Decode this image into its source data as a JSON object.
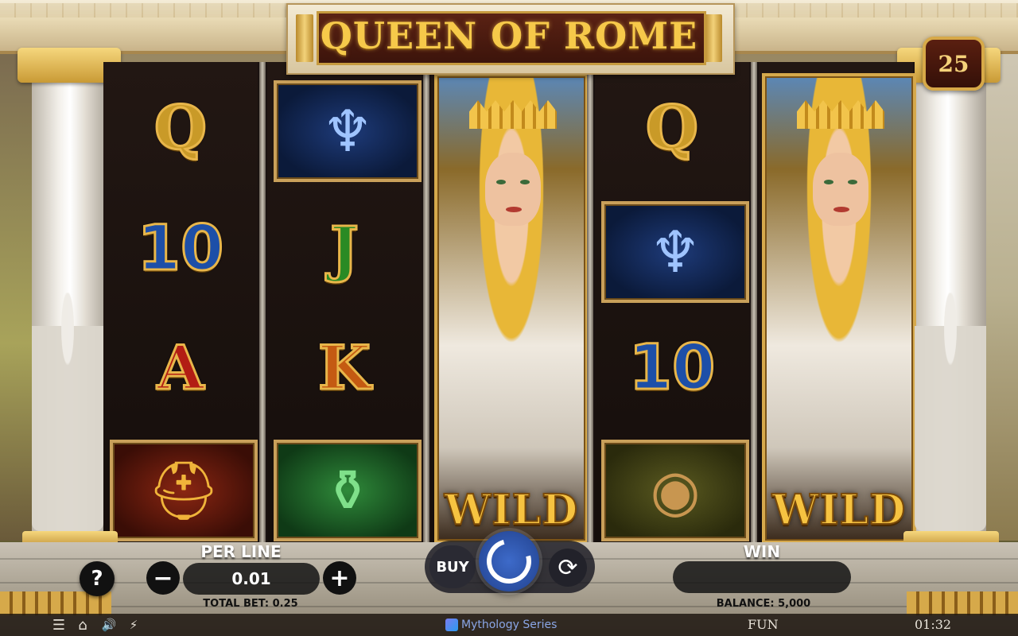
{
  "title": "QUEEN OF ROME",
  "lines_count": "25",
  "reels": [
    [
      {
        "kind": "letter",
        "text": "Q",
        "variant": "q"
      },
      {
        "kind": "letter",
        "text": "10",
        "variant": "10"
      },
      {
        "kind": "letter",
        "text": "A",
        "variant": "a"
      },
      {
        "kind": "tile",
        "icon": "helmet-icon",
        "glyph": "⛑",
        "variant": "helmet"
      }
    ],
    [
      {
        "kind": "tile",
        "icon": "harp-icon",
        "glyph": "♆",
        "variant": "harp"
      },
      {
        "kind": "letter",
        "text": "J",
        "variant": "j"
      },
      {
        "kind": "letter",
        "text": "K",
        "variant": "k"
      },
      {
        "kind": "tile",
        "icon": "vase-icon",
        "glyph": "⚱",
        "variant": "vase"
      }
    ],
    [
      {
        "kind": "wild",
        "text": "WILD",
        "icon": "queen-wild-icon"
      }
    ],
    [
      {
        "kind": "letter",
        "text": "Q",
        "variant": "q"
      },
      {
        "kind": "tile",
        "icon": "harp-icon",
        "glyph": "♆",
        "variant": "harp"
      },
      {
        "kind": "letter",
        "text": "10",
        "variant": "10"
      },
      {
        "kind": "tile",
        "icon": "shield-icon",
        "glyph": "◉",
        "variant": "shield"
      }
    ],
    [
      {
        "kind": "wild",
        "text": "WILD",
        "icon": "queen-wild-icon"
      }
    ]
  ],
  "controls": {
    "help_label": "?",
    "per_line_label": "PER LINE",
    "minus_label": "−",
    "bet_value": "0.01",
    "plus_label": "+",
    "total_bet": "TOTAL BET: 0.25",
    "buy_label": "BUY",
    "autoplay_glyph": "⟳",
    "win_label": "WIN",
    "win_value": "",
    "balance": "BALANCE: 5,000"
  },
  "footer": {
    "menu_glyph": "☰",
    "home_glyph": "⌂",
    "sound_glyph": "🔊",
    "turbo_glyph": "⚡",
    "series_label": "Mythology Series",
    "mode": "FUN",
    "time": "01:32"
  },
  "colors": {
    "gold": "#f6c94a",
    "spin_blue": "#2a4ea0",
    "reel_bg": "#1a1210"
  }
}
